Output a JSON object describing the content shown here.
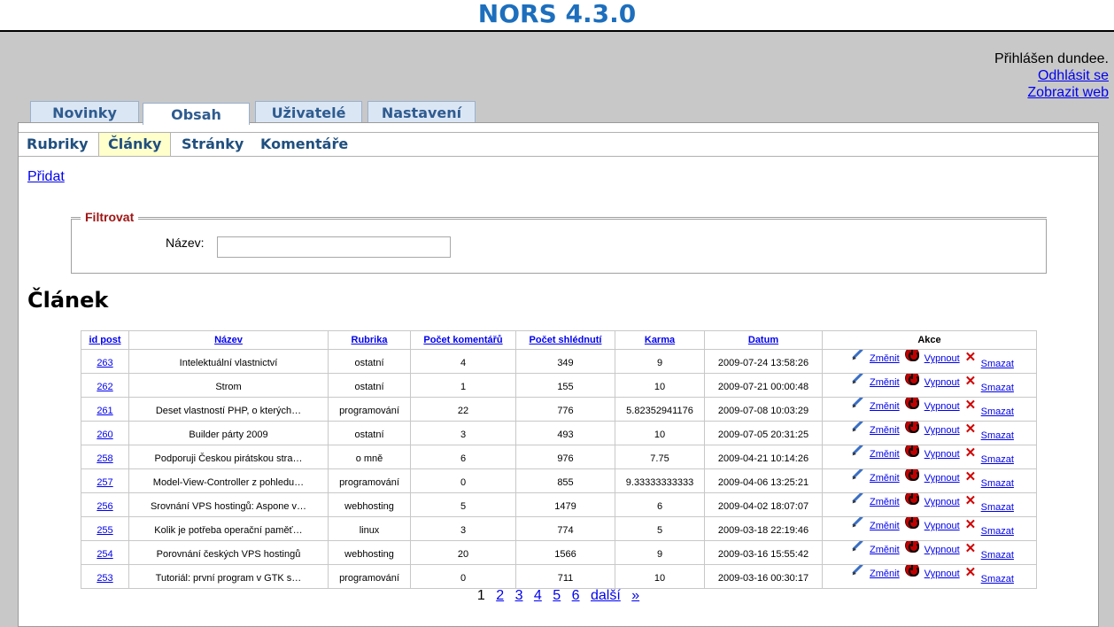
{
  "app": {
    "title": "NORS 4.3.0"
  },
  "user": {
    "status": "Přihlášen dundee.",
    "logout": "Odhlásit se",
    "view_web": "Zobrazit web"
  },
  "main_tabs": [
    {
      "label": "Novinky",
      "active": false
    },
    {
      "label": "Obsah",
      "active": true
    },
    {
      "label": "Uživatelé",
      "active": false
    },
    {
      "label": "Nastavení",
      "active": false
    }
  ],
  "sub_tabs": [
    {
      "label": "Rubriky",
      "active": false
    },
    {
      "label": "Články",
      "active": true
    },
    {
      "label": "Stránky",
      "active": false
    },
    {
      "label": "Komentáře",
      "active": false
    }
  ],
  "add_link": "Přidat",
  "filter": {
    "legend": "Filtrovat",
    "name_label": "Název:",
    "name_value": ""
  },
  "section_title": "Článek",
  "table": {
    "headers": [
      "id post",
      "Název",
      "Rubrika",
      "Počet komentářů",
      "Počet shlédnutí",
      "Karma",
      "Datum",
      "Akce"
    ],
    "actions": {
      "edit": "Změnit",
      "disable": "Vypnout",
      "delete": "Smazat"
    },
    "rows": [
      [
        "263",
        "Intelektuální vlastnictví",
        "ostatní",
        "4",
        "349",
        "9",
        "2009-07-24 13:58:26"
      ],
      [
        "262",
        "Strom",
        "ostatní",
        "1",
        "155",
        "10",
        "2009-07-21 00:00:48"
      ],
      [
        "261",
        "Deset vlastností PHP, o kterých…",
        "programování",
        "22",
        "776",
        "5.82352941176",
        "2009-07-08 10:03:29"
      ],
      [
        "260",
        "Builder párty 2009",
        "ostatní",
        "3",
        "493",
        "10",
        "2009-07-05 20:31:25"
      ],
      [
        "258",
        "Podporuji Českou pirátskou stra…",
        "o mně",
        "6",
        "976",
        "7.75",
        "2009-04-21 10:14:26"
      ],
      [
        "257",
        "Model-View-Controller z pohledu…",
        "programování",
        "0",
        "855",
        "9.33333333333",
        "2009-04-06 13:25:21"
      ],
      [
        "256",
        "Srovnání VPS hostingů: Aspone v…",
        "webhosting",
        "5",
        "1479",
        "6",
        "2009-04-02 18:07:07"
      ],
      [
        "255",
        "Kolik je potřeba operační paměť…",
        "linux",
        "3",
        "774",
        "5",
        "2009-03-18 22:19:46"
      ],
      [
        "254",
        "Porovnání českých VPS hostingů",
        "webhosting",
        "20",
        "1566",
        "9",
        "2009-03-16 15:55:42"
      ],
      [
        "253",
        "Tutoriál: první program v GTK s…",
        "programování",
        "0",
        "711",
        "10",
        "2009-03-16 00:30:17"
      ]
    ]
  },
  "pager": {
    "current": "1",
    "pages": [
      "2",
      "3",
      "4",
      "5",
      "6"
    ],
    "next": "další",
    "last": "»"
  }
}
